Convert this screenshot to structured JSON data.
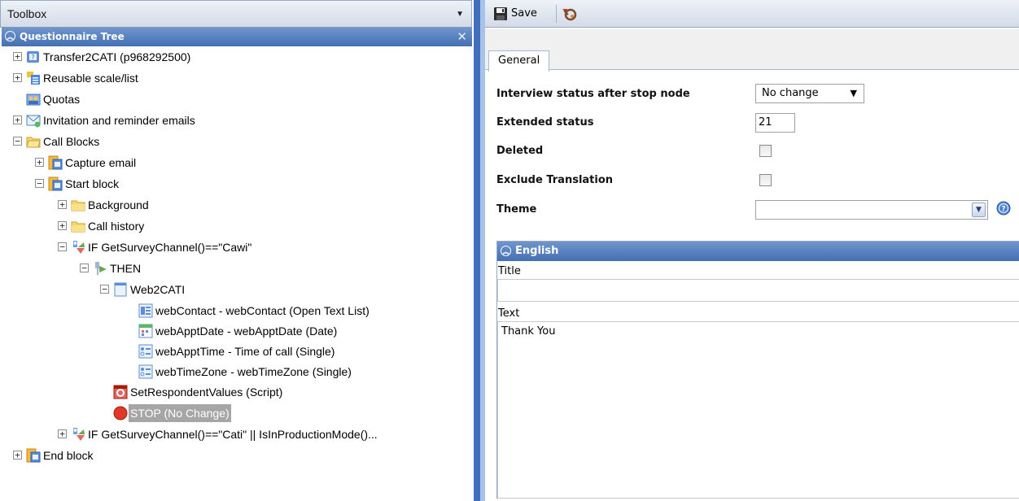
{
  "toolbox": {
    "title": "Toolbox"
  },
  "questionnaire_tree": {
    "title": "Questionnaire Tree",
    "nodes": [
      {
        "label": "Transfer2CATI (p968292500)",
        "icon": "survey-icon",
        "expander": "+"
      },
      {
        "label": "Reusable scale/list",
        "icon": "list-icon",
        "expander": "+"
      },
      {
        "label": "Quotas",
        "icon": "quotas-icon",
        "expander": ""
      },
      {
        "label": "Invitation and reminder emails",
        "icon": "email-icon",
        "expander": "+"
      },
      {
        "label": "Call Blocks",
        "icon": "folder-open-icon",
        "expander": "−"
      },
      {
        "label": "Capture email",
        "icon": "block-icon",
        "expander": "+"
      },
      {
        "label": "Start block",
        "icon": "block-icon",
        "expander": "−"
      },
      {
        "label": "Background",
        "icon": "folder-icon",
        "expander": "+"
      },
      {
        "label": "Call history",
        "icon": "folder-icon",
        "expander": "+"
      },
      {
        "label": "IF GetSurveyChannel()==\"Cawi\"",
        "icon": "condition-icon",
        "expander": "−"
      },
      {
        "label": "THEN",
        "icon": "then-icon",
        "expander": "−"
      },
      {
        "label": "Web2CATI",
        "icon": "page-icon",
        "expander": "−"
      },
      {
        "label": "webContact - webContact (Open Text List)",
        "icon": "open-text-list-icon",
        "expander": ""
      },
      {
        "label": "webApptDate - webApptDate (Date)",
        "icon": "date-icon",
        "expander": ""
      },
      {
        "label": "webApptTime - Time of call (Single)",
        "icon": "single-icon",
        "expander": ""
      },
      {
        "label": "webTimeZone - webTimeZone (Single)",
        "icon": "single-icon",
        "expander": ""
      },
      {
        "label": "SetRespondentValues (Script)",
        "icon": "script-icon",
        "expander": ""
      },
      {
        "label": "STOP (No Change)",
        "icon": "stop-icon",
        "expander": ""
      },
      {
        "label": "IF GetSurveyChannel()==\"Cati\" || IsInProductionMode()...",
        "icon": "condition-icon",
        "expander": "+"
      },
      {
        "label": "End block",
        "icon": "block-icon",
        "expander": "+"
      }
    ]
  },
  "toolbar": {
    "save_label": "Save"
  },
  "tabs": {
    "general": "General"
  },
  "form": {
    "interview_status_label": "Interview status after stop node",
    "interview_status_value": "No change",
    "extended_status_label": "Extended status",
    "extended_status_value": "21",
    "deleted_label": "Deleted",
    "exclude_translation_label": "Exclude Translation",
    "theme_label": "Theme",
    "theme_value": ""
  },
  "english_panel": {
    "title": "English",
    "title_label": "Title",
    "title_value": "",
    "text_label": "Text",
    "text_value": "Thank You"
  },
  "colors": {
    "header_blue": "#4f7bbf",
    "splitter_blue": "#3f6fbd",
    "selection_gray": "#a6a6a6"
  }
}
